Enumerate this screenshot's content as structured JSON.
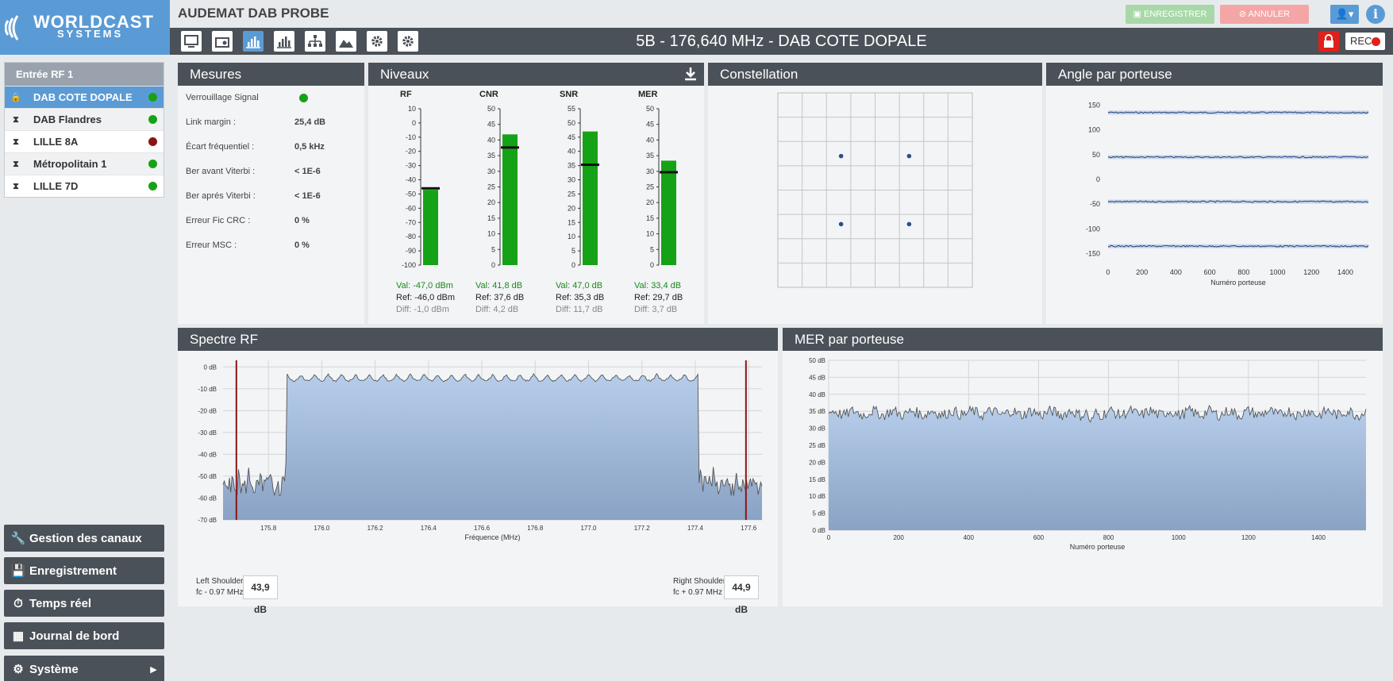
{
  "brand": {
    "line1": "WORLDCAST",
    "line2": "SYSTEMS"
  },
  "app_title": "AUDEMAT DAB PROBE",
  "actions": {
    "save": "ENREGISTRER",
    "cancel": "ANNULER"
  },
  "channel_title": "5B - 176,640 MHz - DAB COTE DOPALE",
  "rec_label": "REC",
  "colors": {
    "accent": "#5b9bd5",
    "dark": "#4b5158",
    "ok": "#16a216",
    "err": "#8b1414",
    "record": "#e0201a"
  },
  "toolbar_icons": [
    "monitor-icon",
    "radio-icon",
    "bar-chart-icon",
    "histogram-icon",
    "sitemap-icon",
    "landscape-icon",
    "gear-icon",
    "settings-icon"
  ],
  "sidebar": {
    "group": "Entrée RF 1",
    "channels": [
      {
        "name": "DAB COTE DOPALE",
        "icon": "lock-icon",
        "status": "ok"
      },
      {
        "name": "DAB Flandres",
        "icon": "hourglass-icon",
        "status": "ok"
      },
      {
        "name": "LILLE 8A",
        "icon": "hourglass-icon",
        "status": "err"
      },
      {
        "name": "Métropolitain 1",
        "icon": "hourglass-icon",
        "status": "ok"
      },
      {
        "name": "LILLE 7D",
        "icon": "hourglass-icon",
        "status": "ok"
      }
    ],
    "nav": [
      {
        "label": "Gestion des canaux",
        "icon": "wrench-icon"
      },
      {
        "label": "Enregistrement",
        "icon": "save-icon"
      },
      {
        "label": "Temps réel",
        "icon": "clock-icon"
      },
      {
        "label": "Journal de bord",
        "icon": "calendar-icon"
      },
      {
        "label": "Système",
        "icon": "gear-icon"
      }
    ]
  },
  "mesures": {
    "title": "Mesures",
    "rows": [
      {
        "label": "Verrouillage Signal",
        "value": ""
      },
      {
        "label": "Link margin :",
        "value": "25,4 dB"
      },
      {
        "label": "Écart fréquentiel :",
        "value": "0,5 kHz"
      },
      {
        "label": "Ber avant Viterbi :",
        "value": "< 1E-6"
      },
      {
        "label": "Ber aprés Viterbi :",
        "value": "< 1E-6"
      },
      {
        "label": "Erreur Fic CRC :",
        "value": "0 %"
      },
      {
        "label": "Erreur MSC :",
        "value": "0 %"
      }
    ]
  },
  "niveaux": {
    "title": "Niveaux",
    "meters": [
      {
        "name": "RF",
        "min": -100,
        "max": 10,
        "ticks": [
          10,
          0,
          -10,
          -20,
          -30,
          -40,
          -50,
          -60,
          -70,
          -80,
          -90,
          -100
        ],
        "value": -47.0,
        "ref": -46.0,
        "val_text": "Val: -47,0 dBm",
        "ref_text": "Ref: -46,0 dBm",
        "diff_text": "Diff: -1,0 dBm"
      },
      {
        "name": "CNR",
        "min": 0,
        "max": 50,
        "ticks": [
          50,
          45,
          40,
          35,
          30,
          25,
          20,
          15,
          10,
          5,
          0
        ],
        "value": 41.8,
        "ref": 37.6,
        "val_text": "Val: 41,8 dB",
        "ref_text": "Ref: 37,6 dB",
        "diff_text": "Diff: 4,2 dB"
      },
      {
        "name": "SNR",
        "min": 0,
        "max": 55,
        "ticks": [
          55,
          50,
          45,
          40,
          35,
          30,
          25,
          20,
          15,
          10,
          5,
          0
        ],
        "value": 47.0,
        "ref": 35.3,
        "val_text": "Val: 47,0 dB",
        "ref_text": "Ref: 35,3 dB",
        "diff_text": "Diff: 11,7 dB"
      },
      {
        "name": "MER",
        "min": 0,
        "max": 50,
        "ticks": [
          50,
          45,
          40,
          35,
          30,
          25,
          20,
          15,
          10,
          5,
          0
        ],
        "value": 33.4,
        "ref": 29.7,
        "val_text": "Val: 33,4 dB",
        "ref_text": "Ref: 29,7 dB",
        "diff_text": "Diff: 3,7 dB"
      }
    ]
  },
  "constellation": {
    "title": "Constellation"
  },
  "angle": {
    "title": "Angle par porteuse"
  },
  "spectre": {
    "title": "Spectre RF",
    "left_shoulder": {
      "label": "Left Shoulder",
      "sub": "fc - 0.97 MHz",
      "value": "43,9 dB"
    },
    "right_shoulder": {
      "label": "Right Shoulder",
      "sub": "fc + 0.97 MHz",
      "value": "44,9 dB"
    }
  },
  "mer_porteuse": {
    "title": "MER par porteuse"
  },
  "chart_data": [
    {
      "type": "scatter",
      "title": "Constellation",
      "points": [
        [
          -1,
          1
        ],
        [
          1,
          1
        ],
        [
          -1,
          -1
        ],
        [
          1,
          -1
        ]
      ]
    },
    {
      "type": "scatter",
      "title": "Angle par porteuse",
      "xlabel": "Numéro porteuse",
      "ylabel": "",
      "xlim": [
        0,
        1536
      ],
      "ylim": [
        -170,
        170
      ],
      "xticks": [
        0,
        200,
        400,
        600,
        800,
        1000,
        1200,
        1400
      ],
      "yticks": [
        150,
        100,
        50,
        0,
        -50,
        -100,
        -150
      ],
      "series": [
        {
          "values_constant": 135
        },
        {
          "values_constant": 45
        },
        {
          "values_constant": -45
        },
        {
          "values_constant": -135
        }
      ]
    },
    {
      "type": "area",
      "title": "Spectre RF",
      "xlabel": "Fréquence (MHz)",
      "ylabel": "",
      "xlim": [
        175.63,
        177.65
      ],
      "ylim": [
        -70,
        3
      ],
      "xticks": [
        175.8,
        176.0,
        176.2,
        176.4,
        176.6,
        176.8,
        177.0,
        177.2,
        177.4,
        177.6
      ],
      "xtick_labels": [
        "175.8",
        "176.0",
        "176.2",
        "176.4",
        "176.6",
        "176.8",
        "177.0",
        "177.2",
        "177.4",
        "177.6"
      ],
      "yticks": [
        0,
        -10,
        -20,
        -30,
        -40,
        -50,
        -60,
        -70
      ],
      "ytick_labels": [
        "0 dB",
        "-10 dB",
        "-20 dB",
        "-30 dB",
        "-40 dB",
        "-50 dB",
        "-60 dB",
        "-70 dB"
      ],
      "markers": [
        175.68,
        177.59
      ],
      "band": [
        175.87,
        177.41
      ],
      "in_band_level": -3,
      "out_band_level": -50
    },
    {
      "type": "area",
      "title": "MER par porteuse",
      "xlabel": "Numéro porteuse",
      "ylabel": "",
      "xlim": [
        0,
        1536
      ],
      "ylim": [
        0,
        50
      ],
      "xticks": [
        0,
        200,
        400,
        600,
        800,
        1000,
        1200,
        1400
      ],
      "yticks": [
        50,
        45,
        40,
        35,
        30,
        25,
        20,
        15,
        10,
        5,
        0
      ],
      "ytick_labels": [
        "50 dB",
        "45 dB",
        "40 dB",
        "35 dB",
        "30 dB",
        "25 dB",
        "20 dB",
        "15 dB",
        "10 dB",
        "5 dB",
        "0 dB"
      ],
      "mean_level": 34.5
    }
  ]
}
